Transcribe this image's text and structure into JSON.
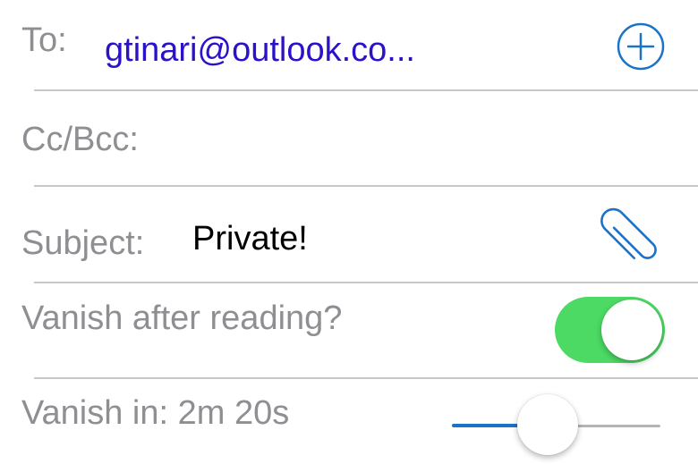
{
  "colors": {
    "accent": "#1a73c9",
    "recipient": "#2a12c9",
    "label": "#8e8e93",
    "divider": "#c8c7cc",
    "toggle_on": "#4cd964",
    "slider_max_track": "#b5b5b5",
    "text": "#000000"
  },
  "to": {
    "label": "To:",
    "value": "gtinari@outlook.co...",
    "add_icon": "plus-circle-icon"
  },
  "cc_bcc": {
    "label": "Cc/Bcc:",
    "value": ""
  },
  "subject": {
    "label": "Subject:",
    "value": "Private!",
    "attach_icon": "paperclip-icon"
  },
  "vanish_after_reading": {
    "label": "Vanish after reading?",
    "enabled": true
  },
  "vanish_in": {
    "label": "Vanish in: 2m 20s",
    "slider_fraction": 0.46
  }
}
